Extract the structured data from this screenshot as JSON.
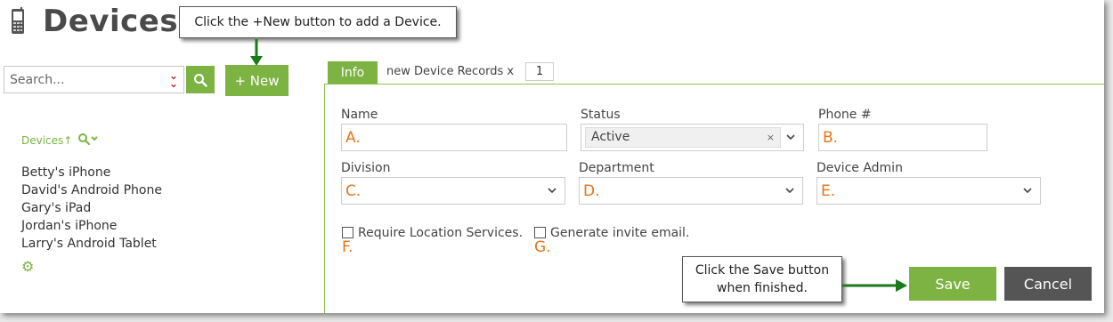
{
  "header": {
    "title": "Devices",
    "icon": "mobile-phone-icon"
  },
  "search": {
    "placeholder": "Search...",
    "icon": "search-icon",
    "dropdown_icon": "double-chevron-down-icon"
  },
  "new_button": {
    "label": "+ New"
  },
  "sidebar": {
    "sort_label": "Devices↑",
    "items": [
      "Betty's iPhone",
      "David's Android Phone",
      "Gary's iPad",
      "Jordan's iPhone",
      "Larry's Android Tablet"
    ],
    "settings_icon": "gear-icon"
  },
  "tabs": {
    "info_label": "Info",
    "records_label": "new Device Records x",
    "records_count": "1"
  },
  "form": {
    "name": {
      "label": "Name",
      "marker": "A."
    },
    "status": {
      "label": "Status",
      "value": "Active",
      "clear": "×"
    },
    "phone": {
      "label": "Phone #",
      "marker": "B."
    },
    "division": {
      "label": "Division",
      "marker": "C."
    },
    "department": {
      "label": "Department",
      "marker": "D."
    },
    "device_admin": {
      "label": "Device Admin",
      "marker": "E."
    },
    "require_location": {
      "label": "Require Location Services.",
      "marker": "F.",
      "checked": false
    },
    "generate_invite": {
      "label": "Generate invite email.",
      "marker": "G.",
      "checked": false
    }
  },
  "actions": {
    "save": "Save",
    "cancel": "Cancel"
  },
  "callouts": {
    "new": "Click the +New button to add a Device.",
    "save_line1": "Click the Save button",
    "save_line2": "when finished."
  },
  "colors": {
    "accent": "#7cb342",
    "marker": "#e8731a",
    "cancel": "#555555",
    "arrow": "#1b7a1b"
  }
}
